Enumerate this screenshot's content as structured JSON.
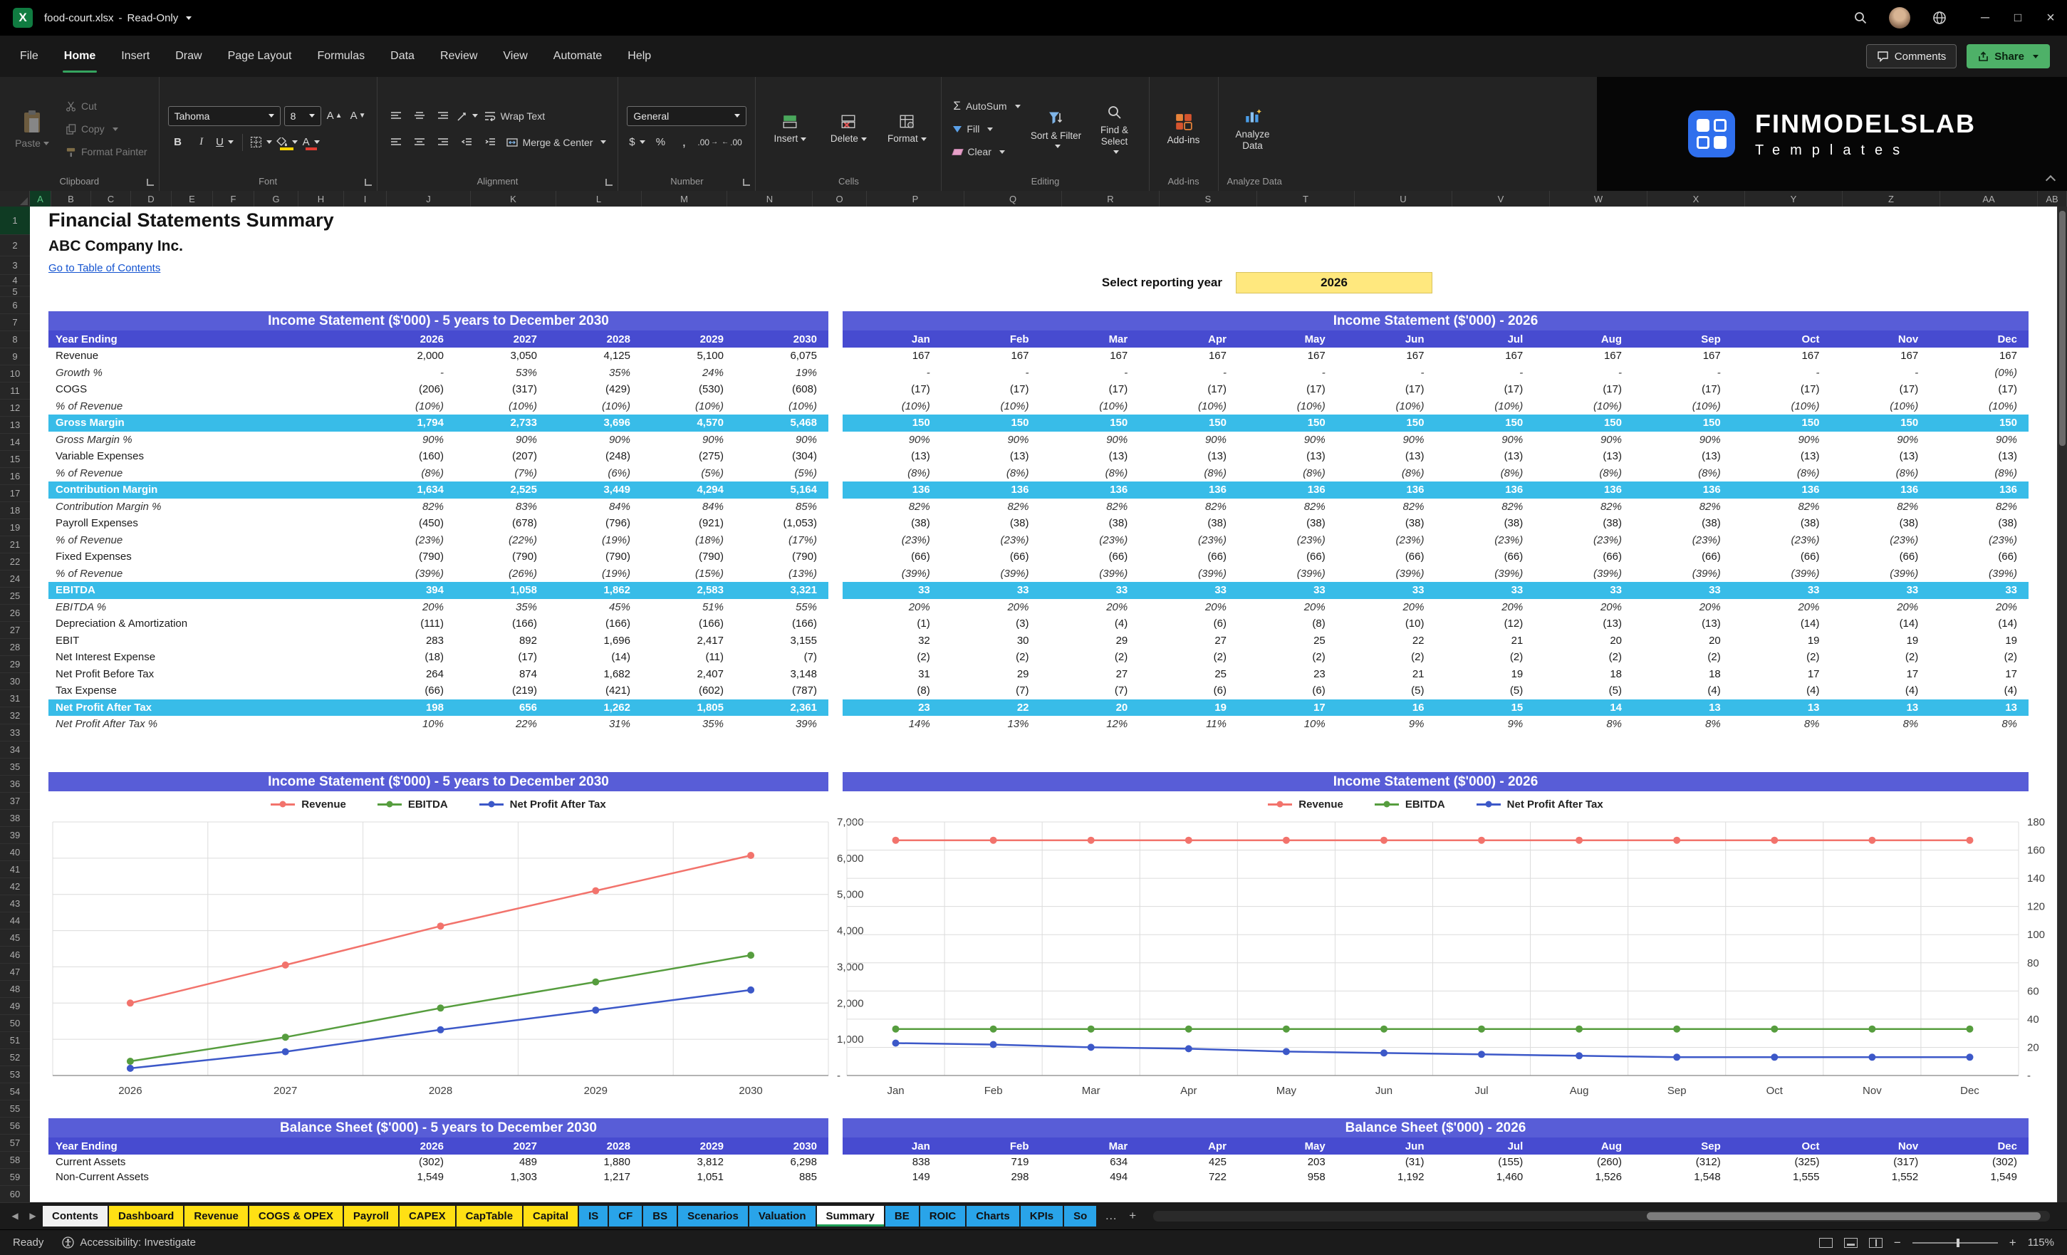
{
  "titlebar": {
    "filename": "food-court.xlsx",
    "mode": "Read-Only"
  },
  "menubar": {
    "tabs": [
      "File",
      "Home",
      "Insert",
      "Draw",
      "Page Layout",
      "Formulas",
      "Data",
      "Review",
      "View",
      "Automate",
      "Help"
    ],
    "active_tab": "Home",
    "comments": "Comments",
    "share": "Share"
  },
  "ribbon": {
    "clipboard": {
      "label": "Clipboard",
      "paste": "Paste",
      "cut": "Cut",
      "copy": "Copy",
      "format_painter": "Format Painter"
    },
    "font": {
      "label": "Font",
      "name": "Tahoma",
      "size": "8"
    },
    "alignment": {
      "label": "Alignment",
      "wrap": "Wrap Text",
      "merge": "Merge & Center"
    },
    "number": {
      "label": "Number",
      "format": "General"
    },
    "cells": {
      "label": "Cells",
      "insert": "Insert",
      "delete": "Delete",
      "format": "Format"
    },
    "editing": {
      "label": "Editing",
      "autosum": "AutoSum",
      "fill": "Fill",
      "clear": "Clear",
      "sort": "Sort & Filter",
      "find": "Find & Select"
    },
    "addins_label": "Add-ins",
    "analyze": "Analyze Data",
    "brand": {
      "name": "FINMODELSLAB",
      "sub": "Templates"
    }
  },
  "sheet": {
    "columns": [
      "A",
      "B",
      "C",
      "D",
      "E",
      "F",
      "G",
      "H",
      "I",
      "J",
      "K",
      "L",
      "M",
      "N",
      "O",
      "P",
      "Q",
      "R",
      "S",
      "T",
      "U",
      "V",
      "W",
      "X",
      "Y",
      "Z",
      "AA",
      "AB"
    ],
    "rows": [
      1,
      2,
      3,
      4,
      5,
      6,
      7,
      8,
      9,
      10,
      11,
      12,
      13,
      14,
      15,
      16,
      17,
      18,
      19,
      21,
      22,
      24,
      25,
      26,
      27,
      28,
      29,
      30,
      31,
      32,
      33,
      34,
      35,
      36,
      37,
      38,
      39,
      40,
      41,
      42,
      43,
      44,
      45,
      46,
      47,
      48,
      49,
      50,
      51,
      52,
      53,
      54,
      55,
      56,
      57,
      58,
      59,
      60
    ],
    "header": {
      "title": "Financial Statements Summary",
      "company": "ABC Company Inc.",
      "toc": "Go to Table of Contents",
      "year_label": "Select reporting year",
      "year_value": "2026"
    }
  },
  "annual_is": {
    "title": "Income Statement ($'000) - 5 years to December 2030",
    "corner": "Year Ending",
    "columns": [
      "2026",
      "2027",
      "2028",
      "2029",
      "2030"
    ],
    "rows": [
      {
        "label": "Revenue",
        "style": "num",
        "values": [
          "2,000",
          "3,050",
          "4,125",
          "5,100",
          "6,075"
        ]
      },
      {
        "label": "Growth %",
        "style": "pct",
        "values": [
          "-",
          "53%",
          "35%",
          "24%",
          "19%"
        ]
      },
      {
        "label": "COGS",
        "style": "num",
        "values": [
          "(206)",
          "(317)",
          "(429)",
          "(530)",
          "(608)"
        ]
      },
      {
        "label": "% of Revenue",
        "style": "pct",
        "values": [
          "(10%)",
          "(10%)",
          "(10%)",
          "(10%)",
          "(10%)"
        ]
      },
      {
        "label": "Gross Margin",
        "style": "hl",
        "values": [
          "1,794",
          "2,733",
          "3,696",
          "4,570",
          "5,468"
        ]
      },
      {
        "label": "Gross Margin %",
        "style": "pct",
        "values": [
          "90%",
          "90%",
          "90%",
          "90%",
          "90%"
        ]
      },
      {
        "label": "Variable Expenses",
        "style": "num",
        "values": [
          "(160)",
          "(207)",
          "(248)",
          "(275)",
          "(304)"
        ]
      },
      {
        "label": "% of Revenue",
        "style": "pct",
        "values": [
          "(8%)",
          "(7%)",
          "(6%)",
          "(5%)",
          "(5%)"
        ]
      },
      {
        "label": "Contribution Margin",
        "style": "hl",
        "values": [
          "1,634",
          "2,525",
          "3,449",
          "4,294",
          "5,164"
        ]
      },
      {
        "label": "Contribution Margin %",
        "style": "pct",
        "values": [
          "82%",
          "83%",
          "84%",
          "84%",
          "85%"
        ]
      },
      {
        "label": "Payroll Expenses",
        "style": "num",
        "values": [
          "(450)",
          "(678)",
          "(796)",
          "(921)",
          "(1,053)"
        ]
      },
      {
        "label": "% of Revenue",
        "style": "pct",
        "values": [
          "(23%)",
          "(22%)",
          "(19%)",
          "(18%)",
          "(17%)"
        ]
      },
      {
        "label": "Fixed Expenses",
        "style": "num",
        "values": [
          "(790)",
          "(790)",
          "(790)",
          "(790)",
          "(790)"
        ]
      },
      {
        "label": "% of Revenue",
        "style": "pct",
        "values": [
          "(39%)",
          "(26%)",
          "(19%)",
          "(15%)",
          "(13%)"
        ]
      },
      {
        "label": "EBITDA",
        "style": "hl",
        "values": [
          "394",
          "1,058",
          "1,862",
          "2,583",
          "3,321"
        ]
      },
      {
        "label": "EBITDA %",
        "style": "pct",
        "values": [
          "20%",
          "35%",
          "45%",
          "51%",
          "55%"
        ]
      },
      {
        "label": "Depreciation & Amortization",
        "style": "num",
        "values": [
          "(111)",
          "(166)",
          "(166)",
          "(166)",
          "(166)"
        ]
      },
      {
        "label": "EBIT",
        "style": "num",
        "values": [
          "283",
          "892",
          "1,696",
          "2,417",
          "3,155"
        ]
      },
      {
        "label": "Net Interest Expense",
        "style": "num",
        "values": [
          "(18)",
          "(17)",
          "(14)",
          "(11)",
          "(7)"
        ]
      },
      {
        "label": "Net Profit Before Tax",
        "style": "num",
        "values": [
          "264",
          "874",
          "1,682",
          "2,407",
          "3,148"
        ]
      },
      {
        "label": "Tax Expense",
        "style": "num",
        "values": [
          "(66)",
          "(219)",
          "(421)",
          "(602)",
          "(787)"
        ]
      },
      {
        "label": "Net Profit After Tax",
        "style": "hl",
        "values": [
          "198",
          "656",
          "1,262",
          "1,805",
          "2,361"
        ]
      },
      {
        "label": "Net Profit After Tax %",
        "style": "pct",
        "values": [
          "10%",
          "22%",
          "31%",
          "35%",
          "39%"
        ]
      }
    ]
  },
  "monthly_is": {
    "title": "Income Statement ($'000) - 2026",
    "columns": [
      "Jan",
      "Feb",
      "Mar",
      "Apr",
      "May",
      "Jun",
      "Jul",
      "Aug",
      "Sep",
      "Oct",
      "Nov",
      "Dec"
    ],
    "rows": [
      [
        "167",
        "167",
        "167",
        "167",
        "167",
        "167",
        "167",
        "167",
        "167",
        "167",
        "167",
        "167"
      ],
      [
        "-",
        "-",
        "-",
        "-",
        "-",
        "-",
        "-",
        "-",
        "-",
        "-",
        "-",
        "(0%)"
      ],
      [
        "(17)",
        "(17)",
        "(17)",
        "(17)",
        "(17)",
        "(17)",
        "(17)",
        "(17)",
        "(17)",
        "(17)",
        "(17)",
        "(17)"
      ],
      [
        "(10%)",
        "(10%)",
        "(10%)",
        "(10%)",
        "(10%)",
        "(10%)",
        "(10%)",
        "(10%)",
        "(10%)",
        "(10%)",
        "(10%)",
        "(10%)"
      ],
      [
        "150",
        "150",
        "150",
        "150",
        "150",
        "150",
        "150",
        "150",
        "150",
        "150",
        "150",
        "150"
      ],
      [
        "90%",
        "90%",
        "90%",
        "90%",
        "90%",
        "90%",
        "90%",
        "90%",
        "90%",
        "90%",
        "90%",
        "90%"
      ],
      [
        "(13)",
        "(13)",
        "(13)",
        "(13)",
        "(13)",
        "(13)",
        "(13)",
        "(13)",
        "(13)",
        "(13)",
        "(13)",
        "(13)"
      ],
      [
        "(8%)",
        "(8%)",
        "(8%)",
        "(8%)",
        "(8%)",
        "(8%)",
        "(8%)",
        "(8%)",
        "(8%)",
        "(8%)",
        "(8%)",
        "(8%)"
      ],
      [
        "136",
        "136",
        "136",
        "136",
        "136",
        "136",
        "136",
        "136",
        "136",
        "136",
        "136",
        "136"
      ],
      [
        "82%",
        "82%",
        "82%",
        "82%",
        "82%",
        "82%",
        "82%",
        "82%",
        "82%",
        "82%",
        "82%",
        "82%"
      ],
      [
        "(38)",
        "(38)",
        "(38)",
        "(38)",
        "(38)",
        "(38)",
        "(38)",
        "(38)",
        "(38)",
        "(38)",
        "(38)",
        "(38)"
      ],
      [
        "(23%)",
        "(23%)",
        "(23%)",
        "(23%)",
        "(23%)",
        "(23%)",
        "(23%)",
        "(23%)",
        "(23%)",
        "(23%)",
        "(23%)",
        "(23%)"
      ],
      [
        "(66)",
        "(66)",
        "(66)",
        "(66)",
        "(66)",
        "(66)",
        "(66)",
        "(66)",
        "(66)",
        "(66)",
        "(66)",
        "(66)"
      ],
      [
        "(39%)",
        "(39%)",
        "(39%)",
        "(39%)",
        "(39%)",
        "(39%)",
        "(39%)",
        "(39%)",
        "(39%)",
        "(39%)",
        "(39%)",
        "(39%)"
      ],
      [
        "33",
        "33",
        "33",
        "33",
        "33",
        "33",
        "33",
        "33",
        "33",
        "33",
        "33",
        "33"
      ],
      [
        "20%",
        "20%",
        "20%",
        "20%",
        "20%",
        "20%",
        "20%",
        "20%",
        "20%",
        "20%",
        "20%",
        "20%"
      ],
      [
        "(1)",
        "(3)",
        "(4)",
        "(6)",
        "(8)",
        "(10)",
        "(12)",
        "(13)",
        "(13)",
        "(14)",
        "(14)",
        "(14)"
      ],
      [
        "32",
        "30",
        "29",
        "27",
        "25",
        "22",
        "21",
        "20",
        "20",
        "19",
        "19",
        "19"
      ],
      [
        "(2)",
        "(2)",
        "(2)",
        "(2)",
        "(2)",
        "(2)",
        "(2)",
        "(2)",
        "(2)",
        "(2)",
        "(2)",
        "(2)"
      ],
      [
        "31",
        "29",
        "27",
        "25",
        "23",
        "21",
        "19",
        "18",
        "18",
        "17",
        "17",
        "17"
      ],
      [
        "(8)",
        "(7)",
        "(7)",
        "(6)",
        "(6)",
        "(5)",
        "(5)",
        "(5)",
        "(4)",
        "(4)",
        "(4)",
        "(4)"
      ],
      [
        "23",
        "22",
        "20",
        "19",
        "17",
        "16",
        "15",
        "14",
        "13",
        "13",
        "13",
        "13"
      ],
      [
        "14%",
        "13%",
        "12%",
        "11%",
        "10%",
        "9%",
        "9%",
        "8%",
        "8%",
        "8%",
        "8%",
        "8%"
      ]
    ]
  },
  "annual_bs": {
    "title": "Balance Sheet ($'000) - 5 years to December 2030",
    "corner": "Year Ending",
    "columns": [
      "2026",
      "2027",
      "2028",
      "2029",
      "2030"
    ],
    "rows": [
      {
        "label": "Current Assets",
        "style": "num",
        "values": [
          "(302)",
          "489",
          "1,880",
          "3,812",
          "6,298"
        ]
      },
      {
        "label": "Non-Current Assets",
        "style": "num",
        "values": [
          "1,549",
          "1,303",
          "1,217",
          "1,051",
          "885"
        ]
      }
    ]
  },
  "monthly_bs": {
    "title": "Balance Sheet ($'000) - 2026",
    "columns": [
      "Jan",
      "Feb",
      "Mar",
      "Apr",
      "May",
      "Jun",
      "Jul",
      "Aug",
      "Sep",
      "Oct",
      "Nov",
      "Dec"
    ],
    "rows": [
      [
        "838",
        "719",
        "634",
        "425",
        "203",
        "(31)",
        "(155)",
        "(260)",
        "(312)",
        "(325)",
        "(317)",
        "(302)"
      ],
      [
        "149",
        "298",
        "494",
        "722",
        "958",
        "1,192",
        "1,460",
        "1,526",
        "1,548",
        "1,555",
        "1,552",
        "1,549"
      ]
    ]
  },
  "chart_data": [
    {
      "type": "line",
      "title": "Income Statement ($'000) - 5 years to December 2030",
      "categories": [
        "2026",
        "2027",
        "2028",
        "2029",
        "2030"
      ],
      "series": [
        {
          "name": "Revenue",
          "color": "#F2736C",
          "values": [
            2000,
            3050,
            4125,
            5100,
            6075
          ]
        },
        {
          "name": "EBITDA",
          "color": "#569D3E",
          "values": [
            394,
            1058,
            1862,
            2583,
            3321
          ]
        },
        {
          "name": "Net Profit After Tax",
          "color": "#3C58C8",
          "values": [
            198,
            656,
            1262,
            1805,
            2361
          ]
        }
      ],
      "ylim": [
        0,
        7000
      ],
      "ystep": 1000,
      "ytick_labels": [
        "-",
        "1,000",
        "2,000",
        "3,000",
        "4,000",
        "5,000",
        "6,000",
        "7,000"
      ],
      "grid": true,
      "legend_position": "top"
    },
    {
      "type": "line",
      "title": "Income Statement ($'000) - 2026",
      "categories": [
        "Jan",
        "Feb",
        "Mar",
        "Apr",
        "May",
        "Jun",
        "Jul",
        "Aug",
        "Sep",
        "Oct",
        "Nov",
        "Dec"
      ],
      "series": [
        {
          "name": "Revenue",
          "color": "#F2736C",
          "values": [
            167,
            167,
            167,
            167,
            167,
            167,
            167,
            167,
            167,
            167,
            167,
            167
          ]
        },
        {
          "name": "EBITDA",
          "color": "#569D3E",
          "values": [
            33,
            33,
            33,
            33,
            33,
            33,
            33,
            33,
            33,
            33,
            33,
            33
          ]
        },
        {
          "name": "Net Profit After Tax",
          "color": "#3C58C8",
          "values": [
            23,
            22,
            20,
            19,
            17,
            16,
            15,
            14,
            13,
            13,
            13,
            13
          ]
        }
      ],
      "ylim": [
        0,
        180
      ],
      "ystep": 20,
      "ytick_labels": [
        "-",
        "20",
        "40",
        "60",
        "80",
        "100",
        "120",
        "140",
        "160",
        "180"
      ],
      "grid": true,
      "legend_position": "top"
    }
  ],
  "tabsbar": {
    "tabs": [
      {
        "label": "Contents",
        "color": "white"
      },
      {
        "label": "Dashboard",
        "color": "yellow"
      },
      {
        "label": "Revenue",
        "color": "yellow"
      },
      {
        "label": "COGS & OPEX",
        "color": "yellow"
      },
      {
        "label": "Payroll",
        "color": "yellow"
      },
      {
        "label": "CAPEX",
        "color": "yellow"
      },
      {
        "label": "CapTable",
        "color": "yellow"
      },
      {
        "label": "Capital",
        "color": "yellow"
      },
      {
        "label": "IS",
        "color": "blue"
      },
      {
        "label": "CF",
        "color": "blue"
      },
      {
        "label": "BS",
        "color": "blue"
      },
      {
        "label": "Scenarios",
        "color": "blue"
      },
      {
        "label": "Valuation",
        "color": "blue"
      },
      {
        "label": "Summary",
        "color": "active"
      },
      {
        "label": "BE",
        "color": "blue"
      },
      {
        "label": "ROIC",
        "color": "blue"
      },
      {
        "label": "Charts",
        "color": "blue"
      },
      {
        "label": "KPIs",
        "color": "blue"
      },
      {
        "label": "So",
        "color": "blue"
      }
    ]
  },
  "statusbar": {
    "ready": "Ready",
    "accessibility": "Accessibility: Investigate",
    "zoom": "115%"
  }
}
